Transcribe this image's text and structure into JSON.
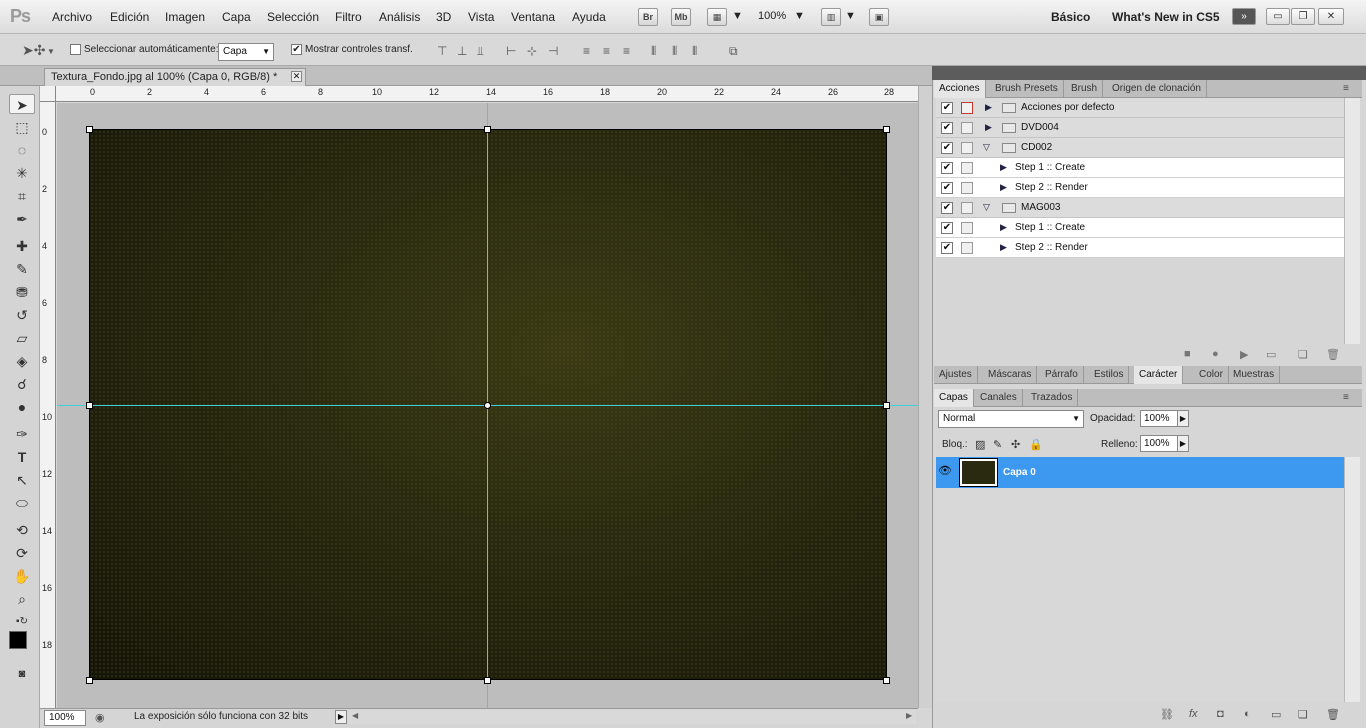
{
  "app": {
    "logo": "Ps"
  },
  "menu": [
    "Archivo",
    "Edición",
    "Imagen",
    "Capa",
    "Selección",
    "Filtro",
    "Análisis",
    "3D",
    "Vista",
    "Ventana",
    "Ayuda"
  ],
  "menubar_buttons": {
    "br": "Br",
    "mb": "Mb",
    "zoom": "100%"
  },
  "workspaces": {
    "basic": "Básico",
    "whats_new": "What's New in CS5"
  },
  "window_controls": {
    "minimize": "▭",
    "restore": "❐",
    "close": "✕"
  },
  "options": {
    "auto_select_label": "Seleccionar automáticamente:",
    "auto_select_checked": "",
    "auto_select_target": "Capa",
    "show_transform_label": "Mostrar controles transf.",
    "show_transform_checked": "✔"
  },
  "document": {
    "tab_title": "Textura_Fondo.jpg al 100% (Capa 0, RGB/8) *",
    "zoom": "100%",
    "status": "La exposición sólo funciona con 32 bits"
  },
  "ruler": {
    "top": [
      "0",
      "2",
      "4",
      "6",
      "8",
      "10",
      "12",
      "14",
      "16",
      "18",
      "20",
      "22",
      "24",
      "26",
      "28"
    ],
    "left": [
      "0",
      "2",
      "4",
      "6",
      "8",
      "10",
      "12",
      "14",
      "16",
      "18"
    ]
  },
  "actions_panel": {
    "tabs": [
      "Acciones",
      "Brush Presets",
      "Brush",
      "Origen de clonación"
    ],
    "rows": [
      {
        "label": "Acciones por defecto",
        "type": "group"
      },
      {
        "label": "DVD004",
        "type": "group"
      },
      {
        "label": "CD002",
        "type": "group"
      },
      {
        "label": "Step 1 :: Create",
        "type": "step"
      },
      {
        "label": "Step 2 :: Render",
        "type": "step"
      },
      {
        "label": "MAG003",
        "type": "group"
      },
      {
        "label": "Step 1 :: Create",
        "type": "step"
      },
      {
        "label": "Step 2 :: Render",
        "type": "step"
      }
    ]
  },
  "adjust_tabs": [
    "Ajustes",
    "Máscaras",
    "Párrafo",
    "Estilos",
    "Carácter",
    "Color",
    "Muestras"
  ],
  "layers_panel": {
    "tabs": [
      "Capas",
      "Canales",
      "Trazados"
    ],
    "blend_mode": "Normal",
    "opacity_label": "Opacidad:",
    "opacity": "100%",
    "lock_label": "Bloq.:",
    "fill_label": "Relleno:",
    "fill": "100%",
    "layers": [
      {
        "name": "Capa 0"
      }
    ]
  },
  "colors": {
    "selection_blue": "#3d98ef",
    "guide": "#3fd0d8",
    "canvas_dark": "#2a2a10"
  }
}
